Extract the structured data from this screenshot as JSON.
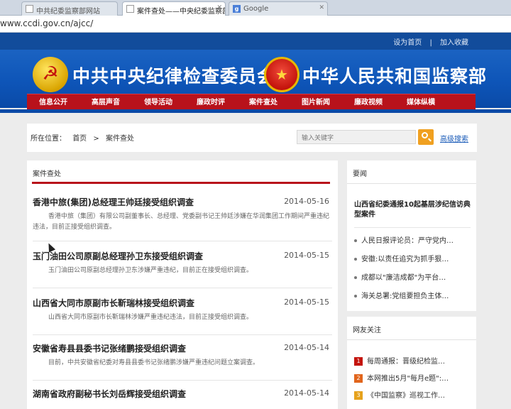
{
  "browser": {
    "tabs": [
      {
        "label": "中共纪委监察部网站"
      },
      {
        "label": "案件查处——中央纪委监察部"
      },
      {
        "label": "Google"
      }
    ],
    "url": "www.ccdi.gov.cn/ajcc/"
  },
  "toplinks": {
    "home": "设为首页",
    "sep": "|",
    "favorite": "加入收藏"
  },
  "banner": {
    "title_left": "中共中央纪律检查委员会",
    "title_right": "中华人民共和国监察部"
  },
  "nav": [
    "信息公开",
    "高层声音",
    "领导活动",
    "廉政时评",
    "案件查处",
    "图片新闻",
    "廉政视频",
    "媒体纵横"
  ],
  "breadcrumb": {
    "label": "所在位置：",
    "home": "首页",
    "sep": ">",
    "current": "案件查处"
  },
  "search": {
    "placeholder": "输入关键字",
    "advanced": "高级搜索"
  },
  "main": {
    "heading": "案件查处",
    "items": [
      {
        "title": "香港中旅(集团)总经理王帅廷接受组织调查",
        "date": "2014-05-16",
        "desc": "香港中旅（集团）有限公司副董事长、总经理、党委副书记王帅廷涉嫌在华润集团工作期间严重违纪违法，目前正接受组织调查。"
      },
      {
        "title": "玉门油田公司原副总经理孙卫东接受组织调查",
        "date": "2014-05-15",
        "desc": "玉门油田公司原副总经理孙卫东涉嫌严重违纪，目前正在接受组织调查。"
      },
      {
        "title": "山西省大同市原副市长靳瑞林接受组织调查",
        "date": "2014-05-15",
        "desc": "山西省大同市原副市长靳瑞林涉嫌严重违纪违法，目前正接受组织调查。"
      },
      {
        "title": "安徽省寿县县委书记张绪鹏接受组织调查",
        "date": "2014-05-14",
        "desc": "目前，中共安徽省纪委对寿县县委书记张绪鹏涉嫌严重违纪问题立案调查。"
      },
      {
        "title": "湖南省政府副秘书长刘岳辉接受组织调查",
        "date": "2014-05-14",
        "desc": ""
      }
    ]
  },
  "side": {
    "news_heading": "要闻",
    "headline": "山西省纪委通报10起基层涉纪信访典型案件",
    "news": [
      "人民日报评论员：严守党内…",
      "安徽:以责任追究为抓手狠…",
      "成都以\"廉洁成都\"为平台…",
      "海关总署:党组要担负主体…"
    ],
    "focus_heading": "网友关注",
    "focus": [
      {
        "rank": "1",
        "text": "每周通报：晋级纪检监…"
      },
      {
        "rank": "2",
        "text": "本网推出5月\"每月e题\":…"
      },
      {
        "rank": "3",
        "text": "《中国监察》巡视工作…"
      }
    ]
  }
}
